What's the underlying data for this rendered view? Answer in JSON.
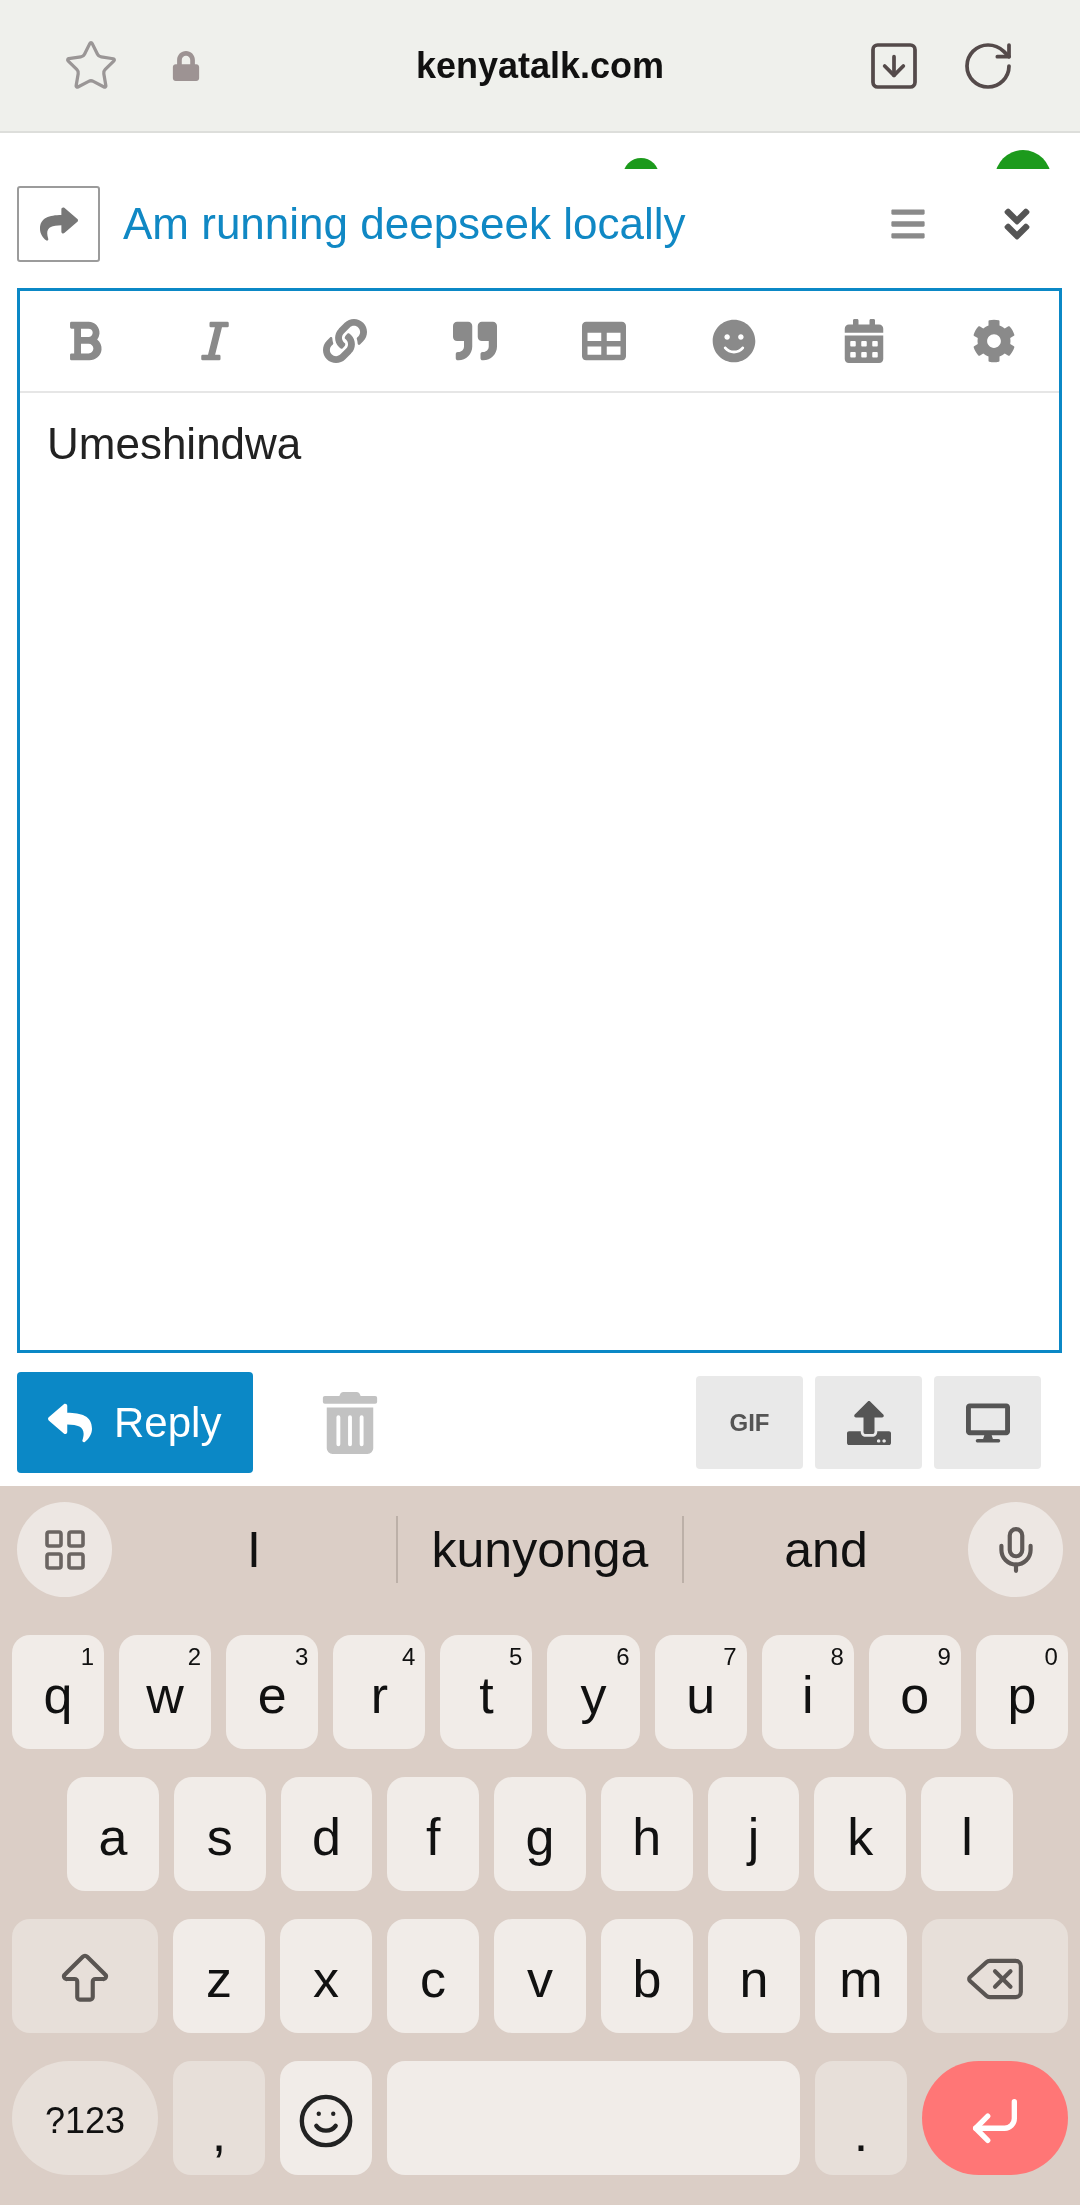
{
  "browser_bar": {
    "url": "kenyatalk.com"
  },
  "composer": {
    "title": "Am running deepseek locally"
  },
  "editor": {
    "value": "Umeshindwa"
  },
  "actions": {
    "reply_label": "Reply",
    "gif_label": "GIF"
  },
  "keyboard": {
    "suggestions": [
      "I",
      "kunyonga",
      "and"
    ],
    "key_rows": [
      {
        "keys": [
          {
            "kind": "letter",
            "label": "q",
            "hint": "1"
          },
          {
            "kind": "letter",
            "label": "w",
            "hint": "2"
          },
          {
            "kind": "letter",
            "label": "e",
            "hint": "3"
          },
          {
            "kind": "letter",
            "label": "r",
            "hint": "4"
          },
          {
            "kind": "letter",
            "label": "t",
            "hint": "5"
          },
          {
            "kind": "letter",
            "label": "y",
            "hint": "6"
          },
          {
            "kind": "letter",
            "label": "u",
            "hint": "7"
          },
          {
            "kind": "letter",
            "label": "i",
            "hint": "8"
          },
          {
            "kind": "letter",
            "label": "o",
            "hint": "9"
          },
          {
            "kind": "letter",
            "label": "p",
            "hint": "0"
          }
        ]
      },
      {
        "keys": [
          {
            "kind": "letter",
            "label": "a"
          },
          {
            "kind": "letter",
            "label": "s"
          },
          {
            "kind": "letter",
            "label": "d"
          },
          {
            "kind": "letter",
            "label": "f"
          },
          {
            "kind": "letter",
            "label": "g"
          },
          {
            "kind": "letter",
            "label": "h"
          },
          {
            "kind": "letter",
            "label": "j"
          },
          {
            "kind": "letter",
            "label": "k"
          },
          {
            "kind": "letter",
            "label": "l"
          }
        ]
      },
      {
        "keys": [
          {
            "kind": "shift"
          },
          {
            "kind": "letter",
            "label": "z"
          },
          {
            "kind": "letter",
            "label": "x"
          },
          {
            "kind": "letter",
            "label": "c"
          },
          {
            "kind": "letter",
            "label": "v"
          },
          {
            "kind": "letter",
            "label": "b"
          },
          {
            "kind": "letter",
            "label": "n"
          },
          {
            "kind": "letter",
            "label": "m"
          },
          {
            "kind": "backspace"
          }
        ]
      },
      {
        "keys": [
          {
            "kind": "symbols",
            "label": "?123"
          },
          {
            "kind": "punct",
            "label": ","
          },
          {
            "kind": "emoji"
          },
          {
            "kind": "space"
          },
          {
            "kind": "punct",
            "label": "."
          },
          {
            "kind": "enter"
          }
        ]
      }
    ]
  }
}
